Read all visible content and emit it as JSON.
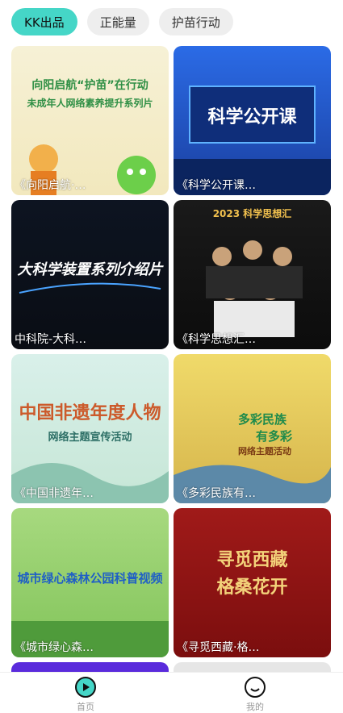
{
  "tabs": [
    {
      "label": "KK出品"
    },
    {
      "label": "正能量"
    },
    {
      "label": "护苗行动"
    }
  ],
  "cards": [
    {
      "title": "《向阳启航·…",
      "banner_lines": [
        "向阳启航“护苗”在行动",
        "未成年人网络素养提升系列片"
      ],
      "accent": "#2f8f45"
    },
    {
      "title": "《科学公开课…",
      "banner_lines": [
        "科学公开课"
      ],
      "accent": "#ffffff"
    },
    {
      "title": "中科院-大科…",
      "banner_lines": [
        "大科学装置系列介绍片"
      ],
      "accent": "#ffffff"
    },
    {
      "title": "《科学思想汇…",
      "banner_lines": [
        "2023 科学思想汇"
      ],
      "accent": "#f2c14e"
    },
    {
      "title": "《中国非遗年…",
      "banner_lines": [
        "中国非遗年度人物",
        "网络主题宣传活动"
      ],
      "accent": "#cc5a2b"
    },
    {
      "title": "《多彩民族有…",
      "banner_lines": [
        "多彩民族",
        "有多彩",
        "网络主题活动"
      ],
      "accent": "#1d8a4b"
    },
    {
      "title": "《城市绿心森…",
      "banner_lines": [
        "城市绿心森林公园科普视频"
      ],
      "accent": "#1f5fc6"
    },
    {
      "title": "《寻觅西藏·格…",
      "banner_lines": [
        "寻觅西藏",
        "格桑花开"
      ],
      "accent": "#f3d27a"
    }
  ],
  "nav": {
    "home_label": "首页",
    "mine_label": "我的"
  }
}
